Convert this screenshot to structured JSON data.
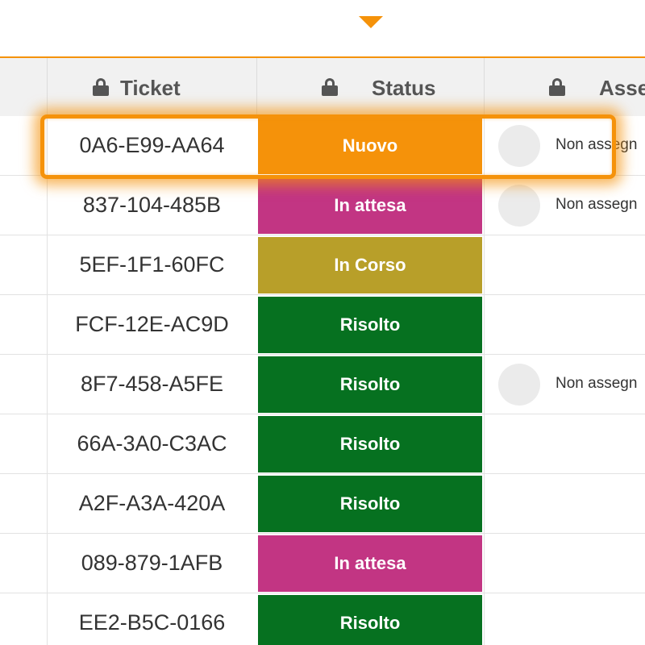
{
  "header": {
    "columns": [
      {
        "label": "Ticket"
      },
      {
        "label": "Status"
      },
      {
        "label": "Asse"
      }
    ]
  },
  "colors": {
    "accent": "#f5920a",
    "status_nuovo": "#f5920a",
    "status_in_attesa": "#c23583",
    "status_in_corso": "#b89f29",
    "status_risolto": "#067120"
  },
  "rows": [
    {
      "ticket": "0A6-E99-AA64",
      "status": "Nuovo",
      "status_color": "#f5920a",
      "assignee": "Non assegn",
      "has_avatar": true
    },
    {
      "ticket": "837-104-485B",
      "status": "In attesa",
      "status_color": "#c23583",
      "assignee": "Non assegn",
      "has_avatar": true
    },
    {
      "ticket": "5EF-1F1-60FC",
      "status": "In Corso",
      "status_color": "#b89f29",
      "assignee": "",
      "has_avatar": false
    },
    {
      "ticket": "FCF-12E-AC9D",
      "status": "Risolto",
      "status_color": "#067120",
      "assignee": "",
      "has_avatar": false
    },
    {
      "ticket": "8F7-458-A5FE",
      "status": "Risolto",
      "status_color": "#067120",
      "assignee": "Non assegn",
      "has_avatar": true
    },
    {
      "ticket": "66A-3A0-C3AC",
      "status": "Risolto",
      "status_color": "#067120",
      "assignee": "",
      "has_avatar": false
    },
    {
      "ticket": "A2F-A3A-420A",
      "status": "Risolto",
      "status_color": "#067120",
      "assignee": "",
      "has_avatar": false
    },
    {
      "ticket": "089-879-1AFB",
      "status": "In attesa",
      "status_color": "#c23583",
      "assignee": "",
      "has_avatar": false
    },
    {
      "ticket": "EE2-B5C-0166",
      "status": "Risolto",
      "status_color": "#067120",
      "assignee": "",
      "has_avatar": false
    }
  ]
}
